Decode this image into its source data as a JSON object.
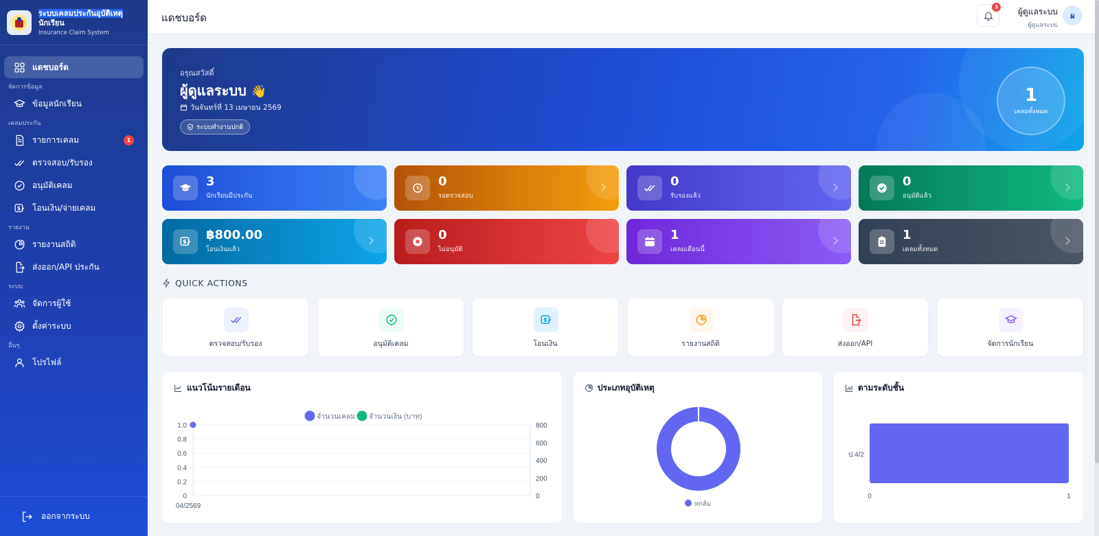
{
  "brand": {
    "title_line1": "ระบบเคลมประกันอุบัติเหตุ",
    "title_line2": "นักเรียน",
    "subtitle": "Insurance Claim System"
  },
  "sidebar": {
    "dashboard": "แดชบอร์ด",
    "section_data": "จัดการข้อมูล",
    "students": "ข้อมูลนักเรียน",
    "section_claims": "เคลมประกัน",
    "claim_list": "รายการเคลม",
    "claim_list_badge": "1",
    "review": "ตรวจสอบ/รับรอง",
    "approve": "อนุมัติเคลม",
    "transfer": "โอนเงิน/จ่ายเคลม",
    "section_reports": "รายงาน",
    "report_stats": "รายงานสถิติ",
    "export_api": "ส่งออก/API ประกัน",
    "section_system": "ระบบ",
    "users": "จัดการผู้ใช้",
    "settings": "ตั้งค่าระบบ",
    "section_other": "อื่นๆ",
    "profile": "โปรไฟล์",
    "logout": "ออกจากระบบ"
  },
  "topbar": {
    "page_title": "แดชบอร์ด",
    "notif_count": "3",
    "user_name": "ผู้ดูแลระบบ",
    "user_role": "ผู้ดูแลระบบ",
    "avatar_initial": "ผ"
  },
  "hero": {
    "greeting": "อรุณสวัสดิ์",
    "name": "ผู้ดูแลระบบ",
    "wave": "👋",
    "date": "วันจันทร์ที่ 13 เมษายน 2569",
    "status": "ระบบทำงานปกติ",
    "total_value": "1",
    "total_label": "เคลมทั้งหมด"
  },
  "stats": [
    {
      "value": "3",
      "label": "นักเรียนมีประกัน"
    },
    {
      "value": "0",
      "label": "รอตรวจสอบ"
    },
    {
      "value": "0",
      "label": "รับรองแล้ว"
    },
    {
      "value": "0",
      "label": "อนุมัติแล้ว"
    },
    {
      "value": "฿800.00",
      "label": "โอนเงินแล้ว"
    },
    {
      "value": "0",
      "label": "ไม่อนุมัติ"
    },
    {
      "value": "1",
      "label": "เคลมเดือนนี้"
    },
    {
      "value": "1",
      "label": "เคลมทั้งหมด"
    }
  ],
  "quick_actions": {
    "title": "QUICK ACTIONS",
    "items": [
      {
        "label": "ตรวจสอบ/รับรอง"
      },
      {
        "label": "อนุมัติเคลม"
      },
      {
        "label": "โอนเงิน"
      },
      {
        "label": "รายงานสถิติ"
      },
      {
        "label": "ส่งออก/API"
      },
      {
        "label": "จัดการนักเรียน"
      }
    ]
  },
  "cards": {
    "monthly": "แนวโน้มรายเดือน",
    "types": "ประเภทอุบัติเหตุ",
    "levels": "ตามระดับชั้น"
  },
  "colors": {
    "indigo": "#6366f1",
    "green": "#10b981"
  },
  "chart_data": [
    {
      "type": "line",
      "title": "แนวโน้มรายเดือน",
      "categories": [
        "04/2569"
      ],
      "series": [
        {
          "name": "จำนวนเคลม",
          "values": [
            1
          ],
          "axis": "left",
          "color": "#6366f1"
        },
        {
          "name": "จำนวนเงิน (บาท)",
          "values": [
            800
          ],
          "axis": "right",
          "color": "#10b981"
        }
      ],
      "yticks_left": [
        "0",
        "0.2",
        "0.4",
        "0.6",
        "0.8",
        "1.0"
      ],
      "yticks_right": [
        "0",
        "200",
        "400",
        "600",
        "800"
      ],
      "ylim_left": [
        0,
        1
      ],
      "ylim_right": [
        0,
        800
      ],
      "legend": "top-center",
      "grid": true
    },
    {
      "type": "pie",
      "title": "ประเภทอุบัติเหตุ",
      "labels": [
        "หกล้ม"
      ],
      "values": [
        1
      ],
      "color": "#6366f1",
      "legend": "bottom"
    },
    {
      "type": "bar",
      "title": "ตามระดับชั้น",
      "orientation": "horizontal",
      "categories": [
        "ป.4/2"
      ],
      "values": [
        1
      ],
      "xticks": [
        "0",
        "1"
      ],
      "xlim": [
        0,
        1
      ],
      "color": "#6366f1"
    }
  ]
}
